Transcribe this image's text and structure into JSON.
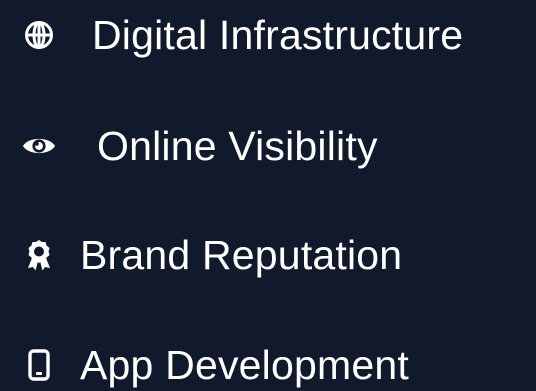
{
  "services": {
    "items": [
      {
        "label": "Digital Infrastructure",
        "icon": "globe-icon"
      },
      {
        "label": "Online Visibility",
        "icon": "eye-icon"
      },
      {
        "label": "Brand Reputation",
        "icon": "award-icon"
      },
      {
        "label": "App Development",
        "icon": "mobile-phone-icon"
      }
    ]
  },
  "colors": {
    "background": "#111a2c",
    "text": "#ffffff"
  }
}
